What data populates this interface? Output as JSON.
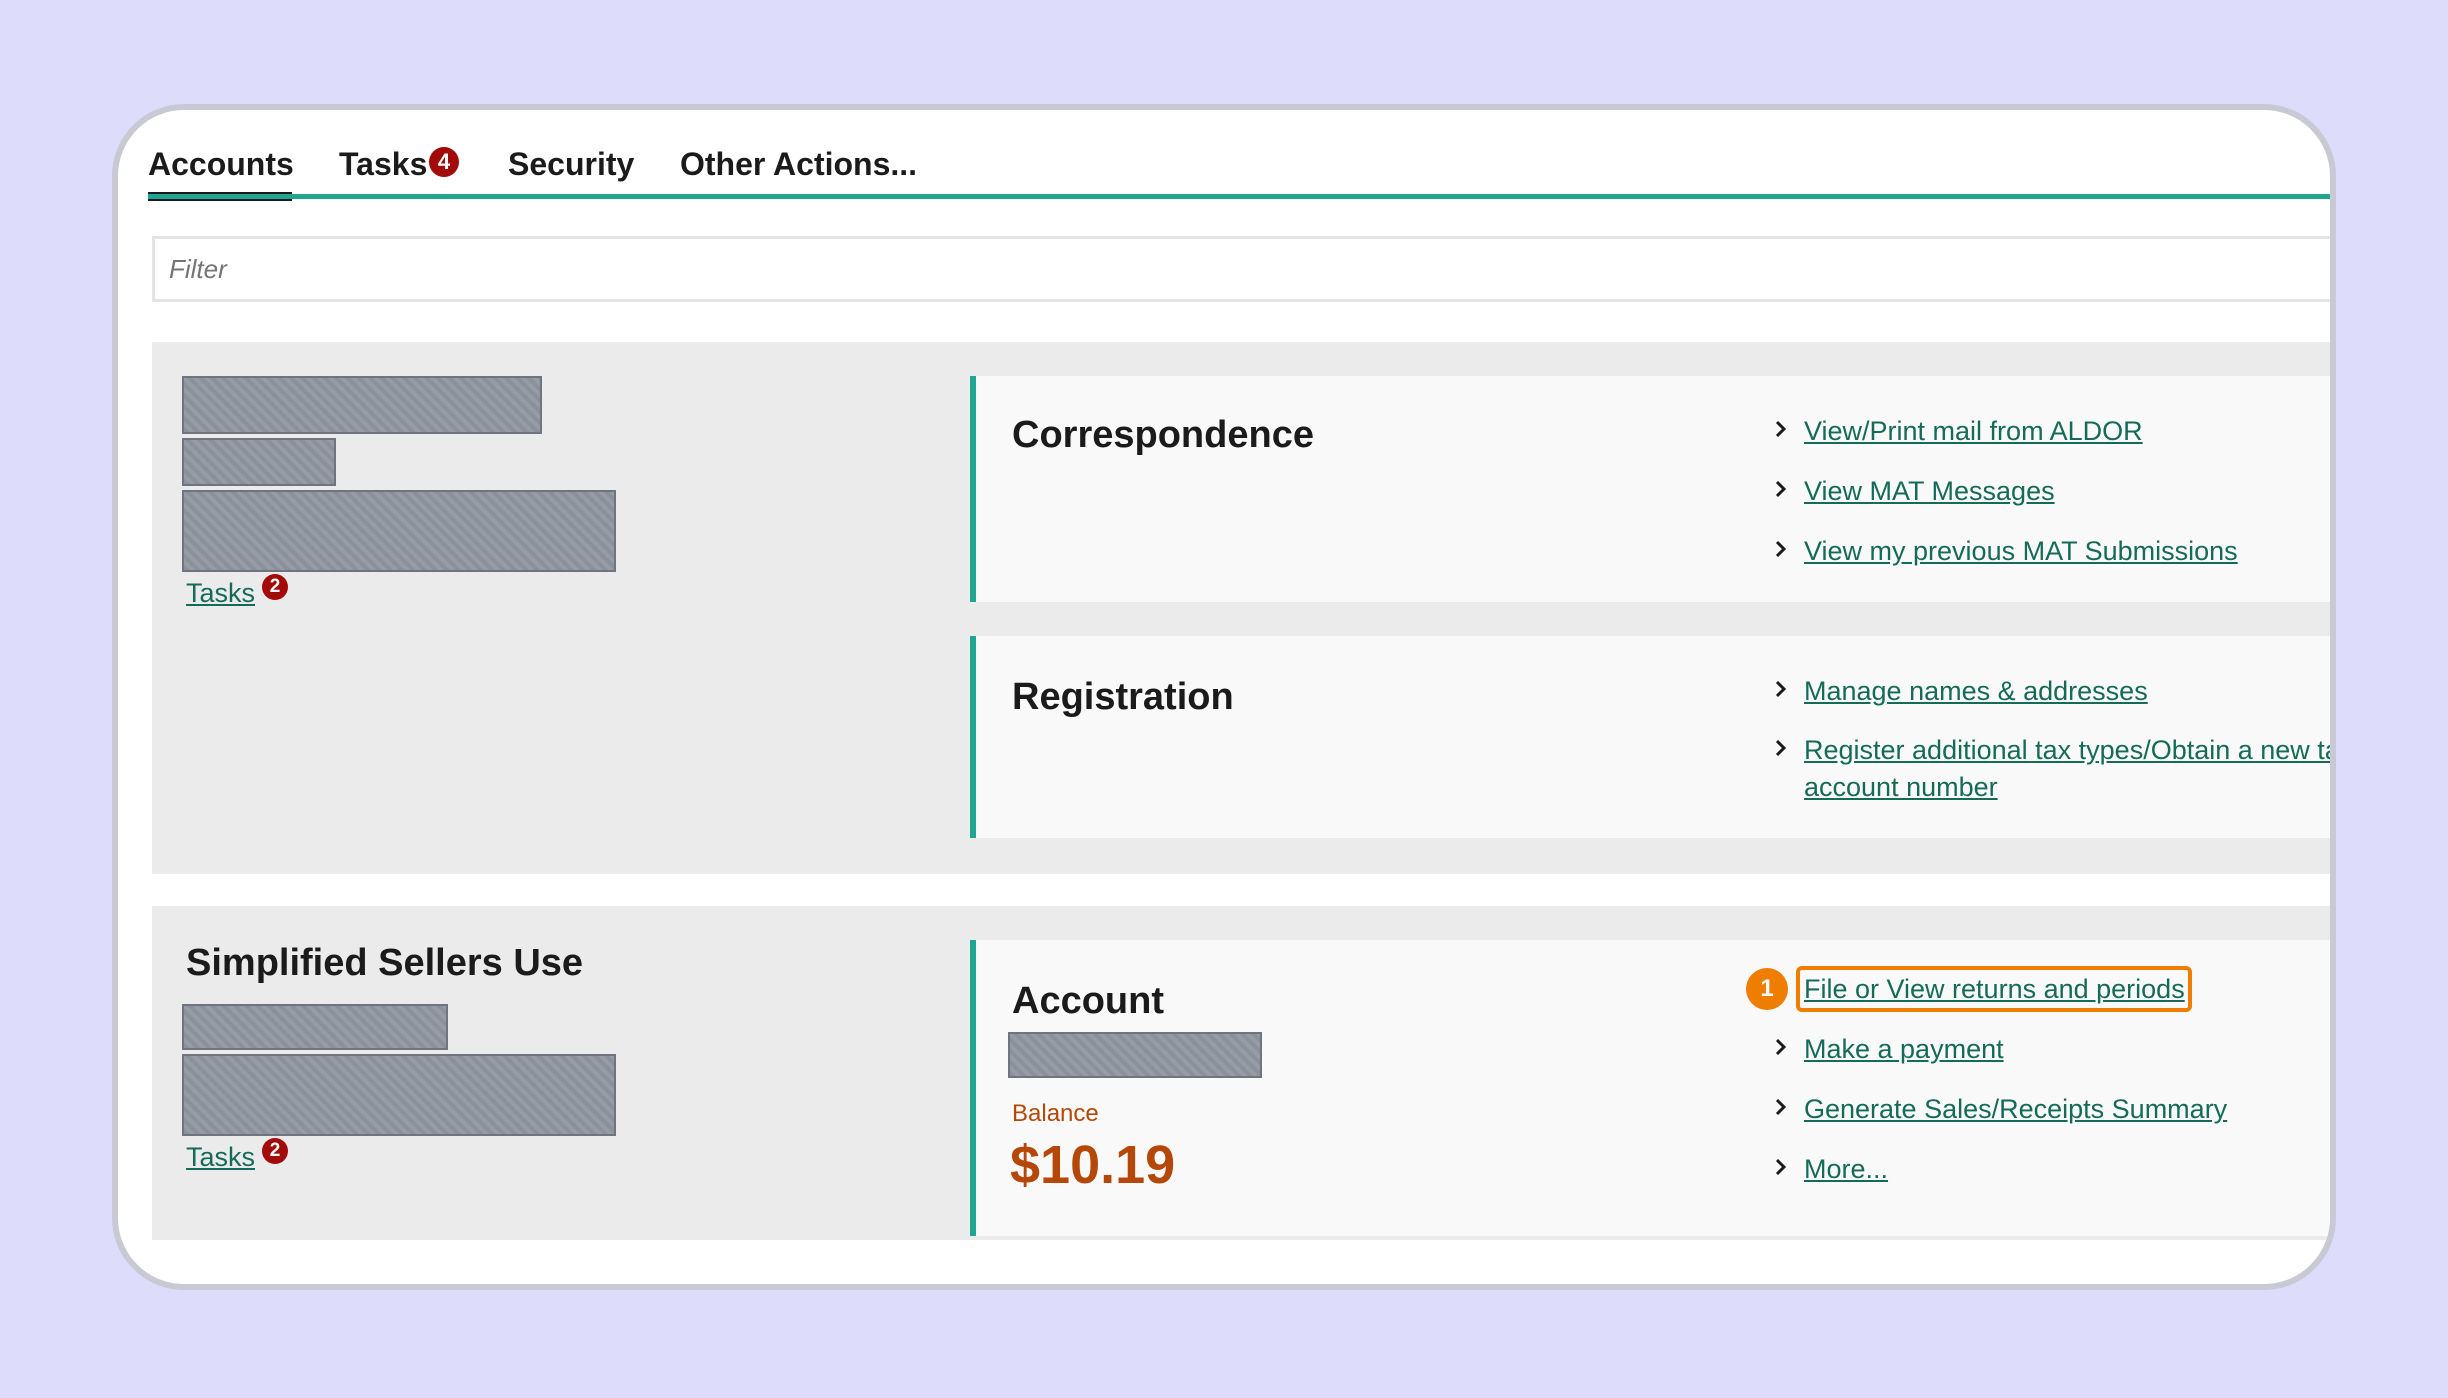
{
  "tabs": [
    {
      "label": "Accounts",
      "active": true
    },
    {
      "label": "Tasks",
      "badge": "4"
    },
    {
      "label": "Security"
    },
    {
      "label": "Other Actions..."
    }
  ],
  "filter": {
    "placeholder": "Filter"
  },
  "group1": {
    "tasks_label": "Tasks",
    "tasks_badge": "2",
    "correspondence": {
      "title": "Correspondence",
      "links": [
        "View/Print mail from ALDOR",
        "View MAT Messages",
        "View my previous MAT Submissions"
      ]
    },
    "registration": {
      "title": "Registration",
      "links": [
        "Manage names & addresses",
        "Register additional tax types/Obtain a new tax",
        "account number"
      ]
    }
  },
  "group2": {
    "title": "Simplified Sellers Use",
    "tasks_label": "Tasks",
    "tasks_badge": "2",
    "account": {
      "title": "Account",
      "balance_label": "Balance",
      "balance_value": "$10.19",
      "callout_number": "1",
      "links": [
        "File or View returns and periods",
        "Make a payment",
        "Generate Sales/Receipts Summary",
        "More..."
      ]
    }
  },
  "colors": {
    "accent": "#1fa592",
    "link": "#146b57",
    "badge": "#a30a0a",
    "highlight": "#ef7d00",
    "balance": "#b54708"
  }
}
